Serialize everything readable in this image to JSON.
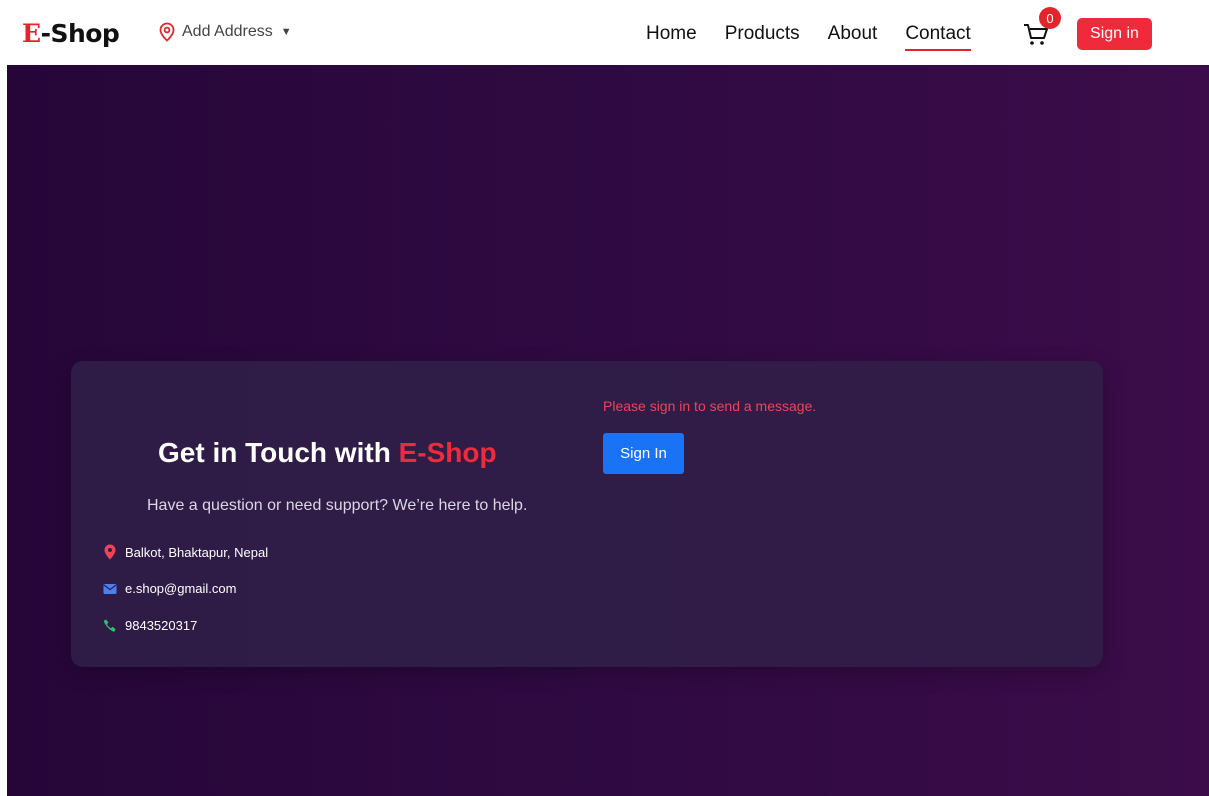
{
  "navbar": {
    "brand_e": "E",
    "brand_rest": "-Shop",
    "address_label": "Add Address",
    "links": [
      {
        "label": "Home"
      },
      {
        "label": "Products"
      },
      {
        "label": "About"
      },
      {
        "label": "Contact"
      }
    ],
    "active_link": "Contact",
    "cart_count": "0",
    "signin_label": "Sign in"
  },
  "contact": {
    "title_prefix": "Get in Touch with ",
    "title_accent": "E-Shop",
    "subtitle": "Have a question or need support? We’re here to help.",
    "address": "Balkot, Bhaktapur, Nepal",
    "email": "e.shop@gmail.com",
    "phone": "9843520317",
    "warning": "Please sign in to send a message.",
    "signin_label": "Sign In"
  },
  "colors": {
    "brand_red": "#ef2b3b",
    "primary_blue": "#1a73f5",
    "hero_bg": "#2f0a42",
    "card_bg": "#301e48"
  },
  "icons": {
    "address": "map-pin-icon",
    "dropdown": "caret-down-icon",
    "cart": "cart-icon",
    "location": "map-marker-icon",
    "email": "envelope-icon",
    "phone": "phone-icon"
  }
}
